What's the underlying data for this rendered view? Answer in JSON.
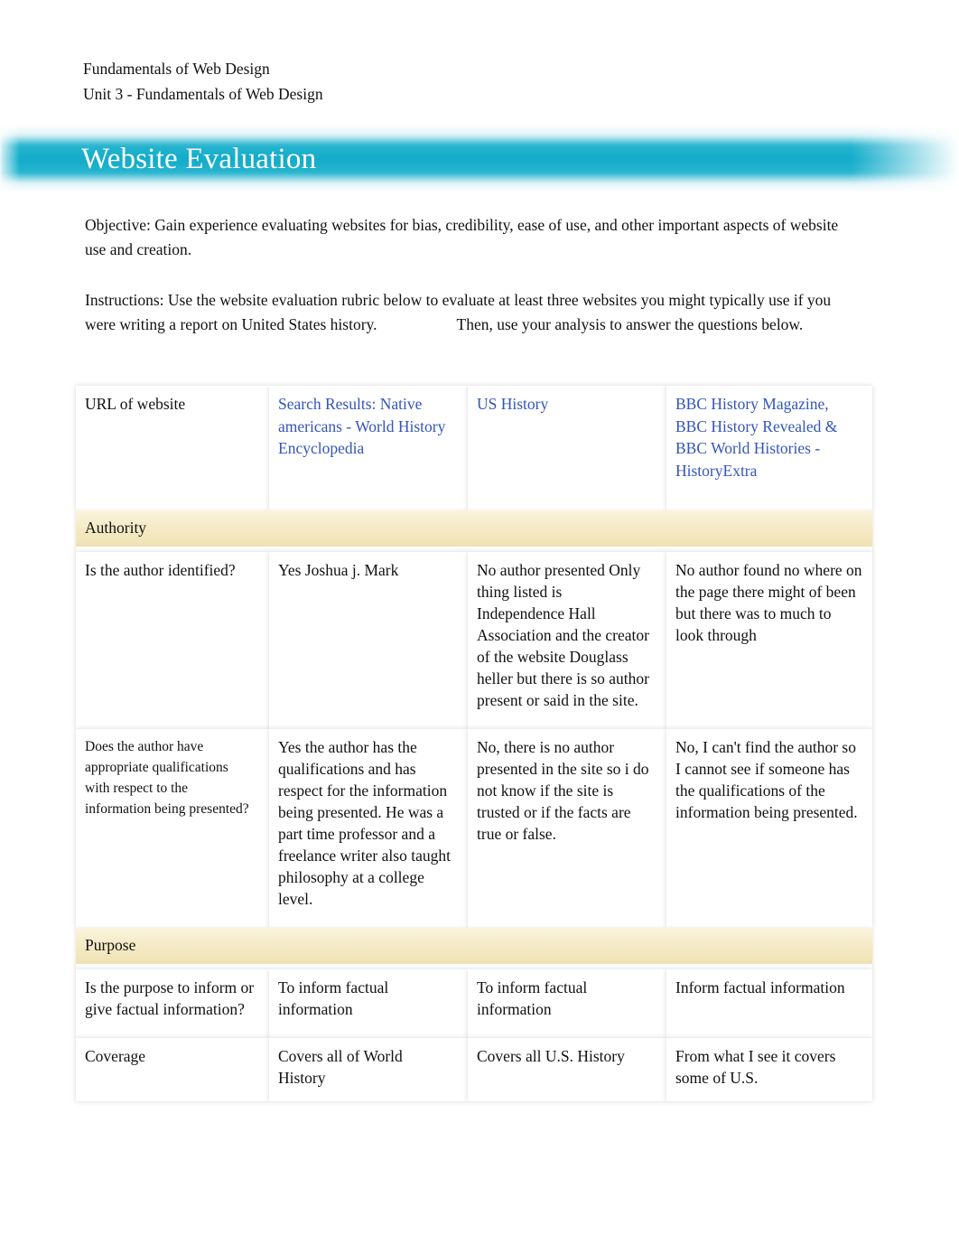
{
  "document": {
    "course_line": "Fundamentals of Web Design",
    "unit_line": "Unit 3 - Fundamentals of Web Design",
    "banner_title": "Website Evaluation",
    "banner_color": "#1ab0cc",
    "link_color": "#3355bb",
    "section_row_color": "#f4e9c3"
  },
  "intro": {
    "objective": "Objective: Gain experience evaluating websites for bias, credibility, ease of use, and other important aspects of website use and creation.",
    "instructions_part1": "Instructions: Use the website evaluation rubric below to evaluate at least three websites you might typically use if you were writing a report on United States history.",
    "instructions_part2": "Then, use your analysis to answer the questions below."
  },
  "rubric": {
    "url_row": {
      "label": "URL of website",
      "site1": "Search Results: Native americans - World History Encyclopedia",
      "site2": "US History",
      "site3": "BBC History Magazine, BBC History Revealed & BBC World Histories - HistoryExtra"
    },
    "sections": [
      {
        "name": "Authority",
        "rows": [
          {
            "question": "Is the author identified?",
            "question_small": false,
            "site1": "Yes Joshua j. Mark",
            "site2": "No author presented Only thing listed is Independence Hall Association and the creator of the website Douglass heller but there is so author present or said in the site.",
            "site3": "No author found no where on the page there might of been but there was to much to look through"
          },
          {
            "question": "Does the author have appropriate qualifications with respect to the information being presented?",
            "question_small": true,
            "site1": "Yes the author has the qualifications and has respect for the information being presented. He was a part time professor and a freelance writer also taught philosophy at a college level.",
            "site2": "No, there is no author presented in the site so i do not know if the site is trusted or if the facts are true or false.",
            "site3": "No, I can't find the author so I cannot see if someone has the qualifications of the information being presented."
          }
        ]
      },
      {
        "name": "Purpose",
        "rows": [
          {
            "question": "Is the purpose to inform or give factual information?",
            "question_small": false,
            "site1": "To inform factual information",
            "site2": "To inform factual information",
            "site3": "Inform factual information"
          },
          {
            "question": "Coverage",
            "question_small": false,
            "site1": "Covers all of World History",
            "site2": "Covers all U.S. History",
            "site3": "From what I see it covers some of U.S."
          }
        ]
      }
    ]
  }
}
